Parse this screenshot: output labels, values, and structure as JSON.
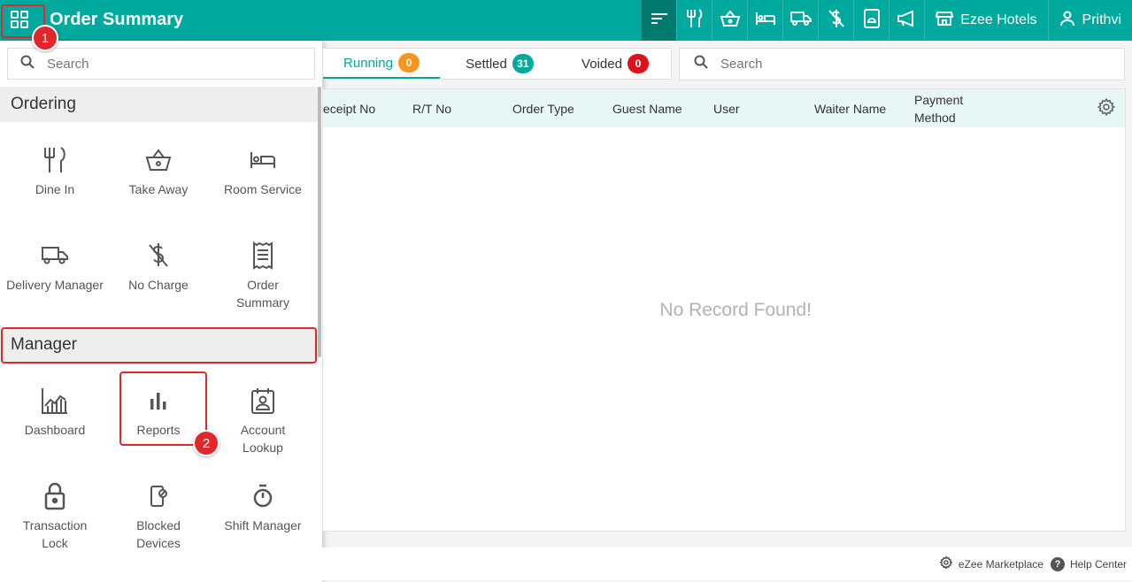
{
  "topbar": {
    "title": "Order Summary",
    "hotel_label": "Ezee Hotels",
    "user_label": "Prithvi",
    "bg_color": "#00a99d",
    "active_icon_bg": "#00796f",
    "icons": [
      "sort-icon",
      "dine-in-icon",
      "take-away-icon",
      "room-service-icon",
      "delivery-icon",
      "no-charge-icon",
      "room-bell-icon",
      "announcement-icon",
      "store-icon",
      "user-icon"
    ]
  },
  "sidebar": {
    "search_placeholder": "Search",
    "sections": [
      {
        "title": "Ordering",
        "tiles": [
          {
            "label": "Dine In",
            "icon": "dine-in-icon"
          },
          {
            "label": "Take Away",
            "icon": "basket-icon"
          },
          {
            "label": "Room Service",
            "icon": "bed-icon"
          },
          {
            "label": "Delivery Manager",
            "icon": "truck-icon"
          },
          {
            "label": "No Charge",
            "icon": "no-charge-icon"
          },
          {
            "label": "Order Summary",
            "icon": "receipt-icon"
          }
        ]
      },
      {
        "title": "Manager",
        "tiles": [
          {
            "label": "Dashboard",
            "icon": "dashboard-chart-icon"
          },
          {
            "label": "Reports",
            "icon": "bar-chart-icon"
          },
          {
            "label": "Account Lookup",
            "icon": "account-lookup-icon"
          },
          {
            "label": "Transaction Lock",
            "icon": "lock-icon"
          },
          {
            "label": "Blocked Devices",
            "icon": "blocked-device-icon"
          },
          {
            "label": "Shift Manager",
            "icon": "stopwatch-icon"
          }
        ]
      }
    ]
  },
  "tabs": [
    {
      "label": "Running",
      "count": "0",
      "badge_color": "#f7941d"
    },
    {
      "label": "Settled",
      "count": "31",
      "badge_color": "#00a99d"
    },
    {
      "label": "Voided",
      "count": "0",
      "badge_color": "#e0101a"
    }
  ],
  "main_search": {
    "placeholder": "Search"
  },
  "table": {
    "columns": [
      "eceipt No",
      "R/T No",
      "Order Type",
      "Guest Name",
      "User",
      "Waiter Name",
      "Payment Method"
    ],
    "empty_message": "No Record Found!"
  },
  "footer": {
    "marketplace_label": "eZee Marketplace",
    "help_label": "Help Center"
  },
  "annotations": {
    "badge_1": "1",
    "badge_2": "2",
    "color": "#e0282a"
  }
}
